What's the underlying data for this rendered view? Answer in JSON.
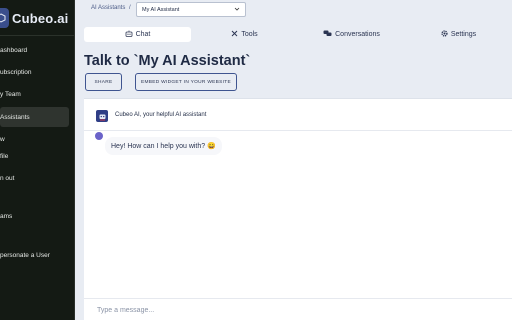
{
  "brand": {
    "name": "Cubeo.ai"
  },
  "sidebar": {
    "items": [
      {
        "label": "ashboard"
      },
      {
        "label": "ubscription"
      },
      {
        "label": "y Team"
      },
      {
        "label": "Assistants"
      },
      {
        "label": "w"
      },
      {
        "label": "file"
      },
      {
        "label": "n out"
      },
      {
        "label": "ams"
      },
      {
        "label": "personate a User"
      }
    ]
  },
  "topbar": {
    "breadcrumb": "AI Assistants",
    "separator": "/",
    "selected_assistant": "My AI Assistant"
  },
  "tabs": [
    {
      "label": "Chat",
      "icon": "robot-icon"
    },
    {
      "label": "Tools",
      "icon": "tools-icon"
    },
    {
      "label": "Conversations",
      "icon": "comments-icon"
    },
    {
      "label": "Settings",
      "icon": "gear-icon"
    }
  ],
  "main": {
    "title": "Talk to `My AI Assistant`",
    "share_label": "Share",
    "embed_label": "Embed widget in your website"
  },
  "chat": {
    "assistant_name": "Cubeo AI, your helpful AI assistant",
    "greeting": "Hey! How can I help you with? 😄",
    "input_placeholder": "Type a message..."
  },
  "colors": {
    "sidebar_bg": "#141a14",
    "page_bg": "#e8ecf3",
    "accent": "#3f5590",
    "panel_bg": "#ffffff"
  }
}
